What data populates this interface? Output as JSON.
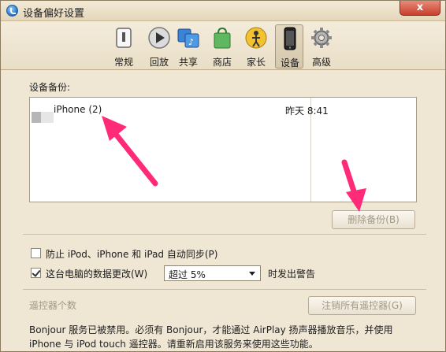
{
  "window": {
    "title": "设备偏好设置",
    "close_label": "x"
  },
  "toolbar": {
    "items": [
      {
        "label": "常规",
        "icon": "general-switch-icon"
      },
      {
        "label": "回放",
        "icon": "playback-icon"
      },
      {
        "label": "共享",
        "icon": "sharing-icon"
      },
      {
        "label": "商店",
        "icon": "store-bag-icon"
      },
      {
        "label": "家长",
        "icon": "parental-icon"
      },
      {
        "label": "设备",
        "icon": "device-icon"
      },
      {
        "label": "高级",
        "icon": "gear-icon"
      }
    ],
    "selected": "设备"
  },
  "backups": {
    "label": "设备备份:",
    "rows": [
      {
        "name": "iPhone (2)",
        "date": "昨天 8:41"
      }
    ],
    "delete_button": "删除备份(B)"
  },
  "options": {
    "prevent_sync": {
      "label": "防止 iPod、iPhone 和 iPad 自动同步(P)",
      "checked": false
    },
    "data_change_warning": {
      "label": "这台电脑的数据更改(W)",
      "checked": true
    },
    "threshold": {
      "value": "超过 5%"
    },
    "warning_suffix": "时发出警告"
  },
  "remotes": {
    "label": "遥控器个数",
    "deregister_button": "注销所有遥控器(G)"
  },
  "footnote": {
    "line1": "Bonjour 服务已被禁用。必须有 Bonjour，才能通过 AirPlay 扬声器播放音乐，并使用",
    "line2": "iPhone 与 iPod touch 遥控器。请重新启用该服务来使用这些功能。"
  },
  "colors": {
    "annotation_arrow": "#ff2a78",
    "window_bg": "#efe6d4"
  }
}
